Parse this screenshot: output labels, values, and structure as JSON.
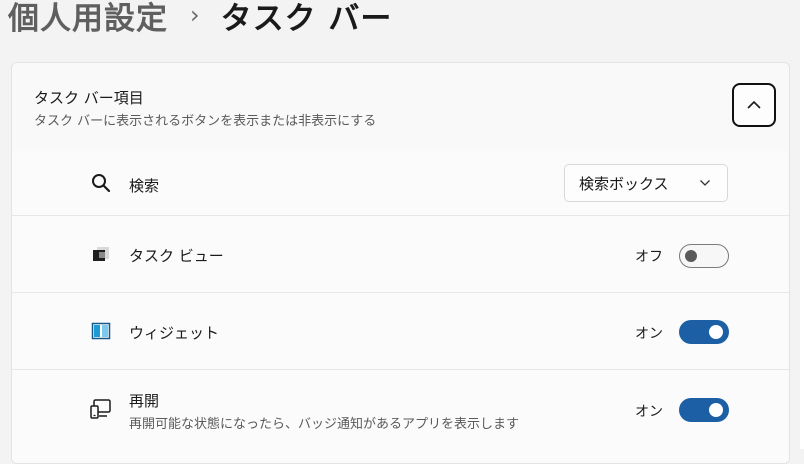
{
  "breadcrumb": {
    "parent": "個人用設定",
    "separator": "›",
    "current": "タスク バー"
  },
  "section": {
    "title": "タスク バー項目",
    "subtitle": "タスク バーに表示されるボタンを表示または非表示にする",
    "collapse_icon": "chevron-up-icon"
  },
  "rows": {
    "search": {
      "icon": "search-icon",
      "label": "検索",
      "dropdown_value": "検索ボックス"
    },
    "taskview": {
      "icon": "task-view-icon",
      "label": "タスク ビュー",
      "state": "オフ",
      "toggled": false
    },
    "widgets": {
      "icon": "widgets-icon",
      "label": "ウィジェット",
      "state": "オン",
      "toggled": true
    },
    "resume": {
      "icon": "resume-icon",
      "label": "再開",
      "description": "再開可能な状態になったら、バッジ通知があるアプリを表示します",
      "state": "オン",
      "toggled": true
    }
  },
  "colors": {
    "accent": "#1d5fa4",
    "widget_icon": "#1e9ad6"
  }
}
